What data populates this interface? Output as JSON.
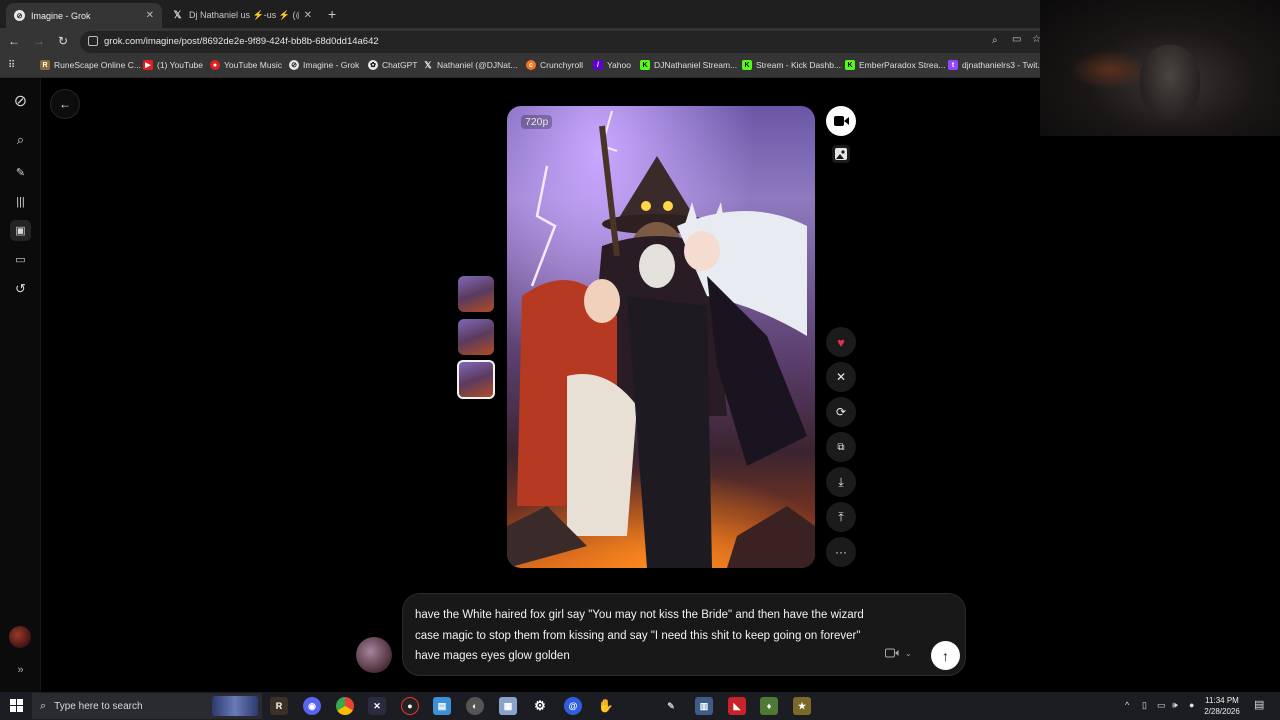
{
  "browser": {
    "tabs": [
      {
        "title": "Imagine - Grok",
        "active": true
      },
      {
        "title": "Dj Nathaniel us ⚡-us ⚡ (@DJNa",
        "active": false
      }
    ],
    "url": "grok.com/imagine/post/8692de2e-9f89-424f-bb8b-68d0dd14a642",
    "bookmarks": [
      {
        "label": "RuneScape Online C...",
        "icon": "runescape-icon",
        "color": "#8a6b34"
      },
      {
        "label": "(1) YouTube",
        "icon": "youtube-icon",
        "color": "#e02020"
      },
      {
        "label": "YouTube Music",
        "icon": "youtube-music-icon",
        "color": "#e02020"
      },
      {
        "label": "Imagine - Grok",
        "icon": "grok-icon",
        "color": "#e8e8e8"
      },
      {
        "label": "ChatGPT",
        "icon": "chatgpt-icon",
        "color": "#e8e8e8"
      },
      {
        "label": "Nathaniel (@DJNat...",
        "icon": "x-icon",
        "color": "#e8e8e8"
      },
      {
        "label": "Crunchyroll",
        "icon": "crunchyroll-icon",
        "color": "#f47521"
      },
      {
        "label": "Yahoo",
        "icon": "yahoo-icon",
        "color": "#6001d2"
      },
      {
        "label": "DJNathaniel Stream...",
        "icon": "kick-icon",
        "color": "#53fc18"
      },
      {
        "label": "Stream - Kick Dashb...",
        "icon": "kick-icon",
        "color": "#53fc18"
      },
      {
        "label": "EmberParadox Strea...",
        "icon": "kick-icon",
        "color": "#53fc18"
      },
      {
        "label": "djnathanielrs3 - Twit...",
        "icon": "twitch-icon",
        "color": "#9146ff"
      }
    ]
  },
  "grok": {
    "sidebar_icons": [
      "grok-logo-icon",
      "search-icon",
      "edit-icon",
      "voice-icon",
      "imagine-icon",
      "folder-icon",
      "history-icon"
    ],
    "resolution": "720p",
    "thumbnails": 3,
    "actions": [
      "heart-icon",
      "x-share-icon",
      "refresh-icon",
      "edit-image-icon",
      "download-icon",
      "upload-icon",
      "more-icon"
    ],
    "prompt": "have the White haired fox girl say \"You may not kiss the Bride\" and then have the wizard case magic to stop them from kissing and say \"I need this shit to keep going on forever\" have mages eyes glow golden"
  },
  "taskbar": {
    "search_placeholder": "Type here to search",
    "time": "11:34 PM",
    "date": "2/28/2026"
  },
  "colors": {
    "page_bg": "#000000",
    "chrome_dark": "#1f1f1f",
    "chrome_mid": "#353535",
    "heart": "#e0344e"
  }
}
